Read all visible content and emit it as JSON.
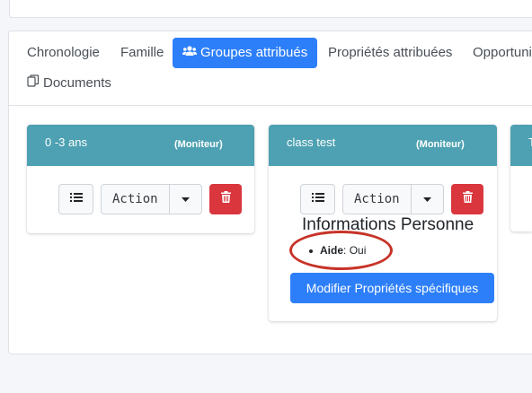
{
  "tabs": {
    "chronologie": "Chronologie",
    "famille": "Famille",
    "groupes": "Groupes attribués",
    "proprietes": "Propriétés attribuées",
    "opportunites": "Opportuni",
    "documents": "Documents"
  },
  "groups": [
    {
      "title": "0 -3 ans",
      "role": "(Moniteur)",
      "action_label": "Action"
    },
    {
      "title": "class test",
      "role": "(Moniteur)",
      "action_label": "Action"
    }
  ],
  "third_group_partial": "T",
  "info": {
    "title": "Informations Personne",
    "items": [
      {
        "key": "Aide",
        "sep": ": ",
        "value": "Oui"
      }
    ],
    "modify_button": "Modifier Propriétés spécifiques"
  },
  "colors": {
    "primary": "#2d7ff9",
    "group_header": "#4ea1b2",
    "danger": "#d9363e",
    "highlight_ellipse": "#c73328"
  },
  "icons": {
    "groupes_tab": "users-icon",
    "documents_tab": "documents-icon",
    "list": "list-icon",
    "caret": "caret-down-icon",
    "delete": "trash-icon"
  }
}
